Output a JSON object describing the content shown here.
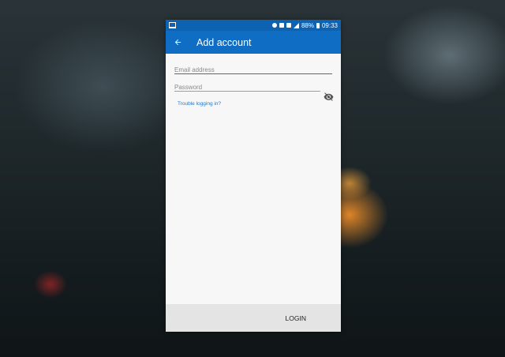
{
  "status_bar": {
    "battery": "88%",
    "time": "09:33",
    "icons": [
      "notification-icon",
      "alarm-icon",
      "bluetooth-icon",
      "sim-icon",
      "signal-icon",
      "battery-icon"
    ]
  },
  "app_bar": {
    "title": "Add account",
    "back_icon": "arrow-left-icon",
    "color": "#0f6dc4"
  },
  "form": {
    "email": {
      "placeholder": "Email address",
      "value": ""
    },
    "password": {
      "placeholder": "Password",
      "value": "",
      "visibility_icon": "eye-off-icon"
    },
    "trouble_link": "Trouble logging in?"
  },
  "footer": {
    "login_label": "LOGIN"
  }
}
